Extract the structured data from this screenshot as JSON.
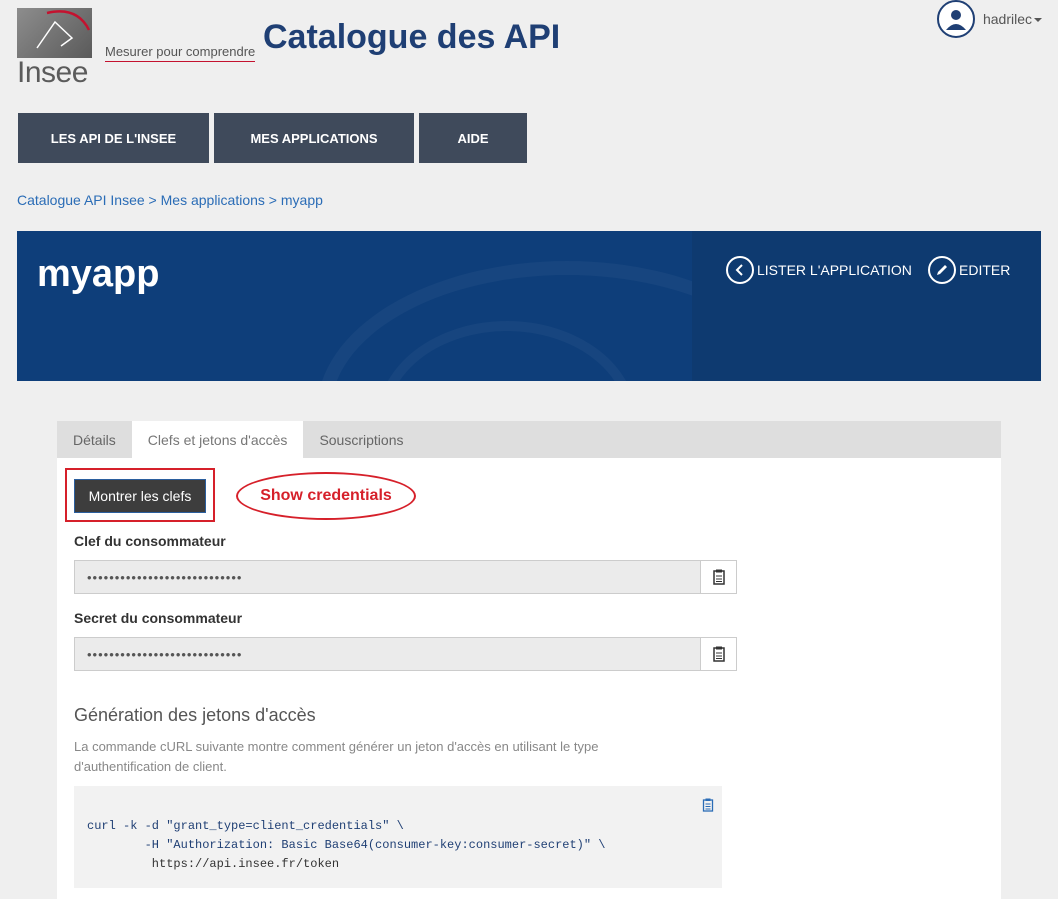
{
  "header": {
    "logo_word": "Insee",
    "tagline": "Mesurer pour comprendre",
    "site_title": "Catalogue des API",
    "user_name": "hadrilec"
  },
  "nav": {
    "items": [
      {
        "label": "LES API DE L'INSEE"
      },
      {
        "label": "MES APPLICATIONS"
      },
      {
        "label": "AIDE"
      }
    ]
  },
  "breadcrumb": {
    "items": [
      "Catalogue API Insee",
      "Mes applications",
      "myapp"
    ],
    "separator": ">"
  },
  "banner": {
    "title": "myapp",
    "list_action": "LISTER L'APPLICATION",
    "edit_action": "EDITER"
  },
  "tabs": [
    {
      "label": "Détails",
      "active": false
    },
    {
      "label": "Clefs et jetons d'accès",
      "active": true
    },
    {
      "label": "Souscriptions",
      "active": false
    }
  ],
  "credentials": {
    "show_button": "Montrer les clefs",
    "annotation": "Show credentials",
    "consumer_key_label": "Clef du consommateur",
    "consumer_key_value": "••••••••••••••••••••••••••••",
    "consumer_secret_label": "Secret du consommateur",
    "consumer_secret_value": "••••••••••••••••••••••••••••"
  },
  "token": {
    "title": "Génération des jetons d'accès",
    "description": "La commande cURL suivante montre comment générer un jeton d'accès en utilisant le type d'authentification de client.",
    "code_lines": [
      "curl -k -d \"grant_type=client_credentials\" \\",
      "        -H \"Authorization: Basic Base64(consumer-key:consumer-secret)\" \\",
      "         https://api.insee.fr/token"
    ]
  },
  "colors": {
    "brand_navy": "#1f3f74",
    "banner": "#0e3e7a",
    "nav": "#3f4a5b",
    "annotation_red": "#d6202a",
    "link": "#2a6cb6"
  }
}
